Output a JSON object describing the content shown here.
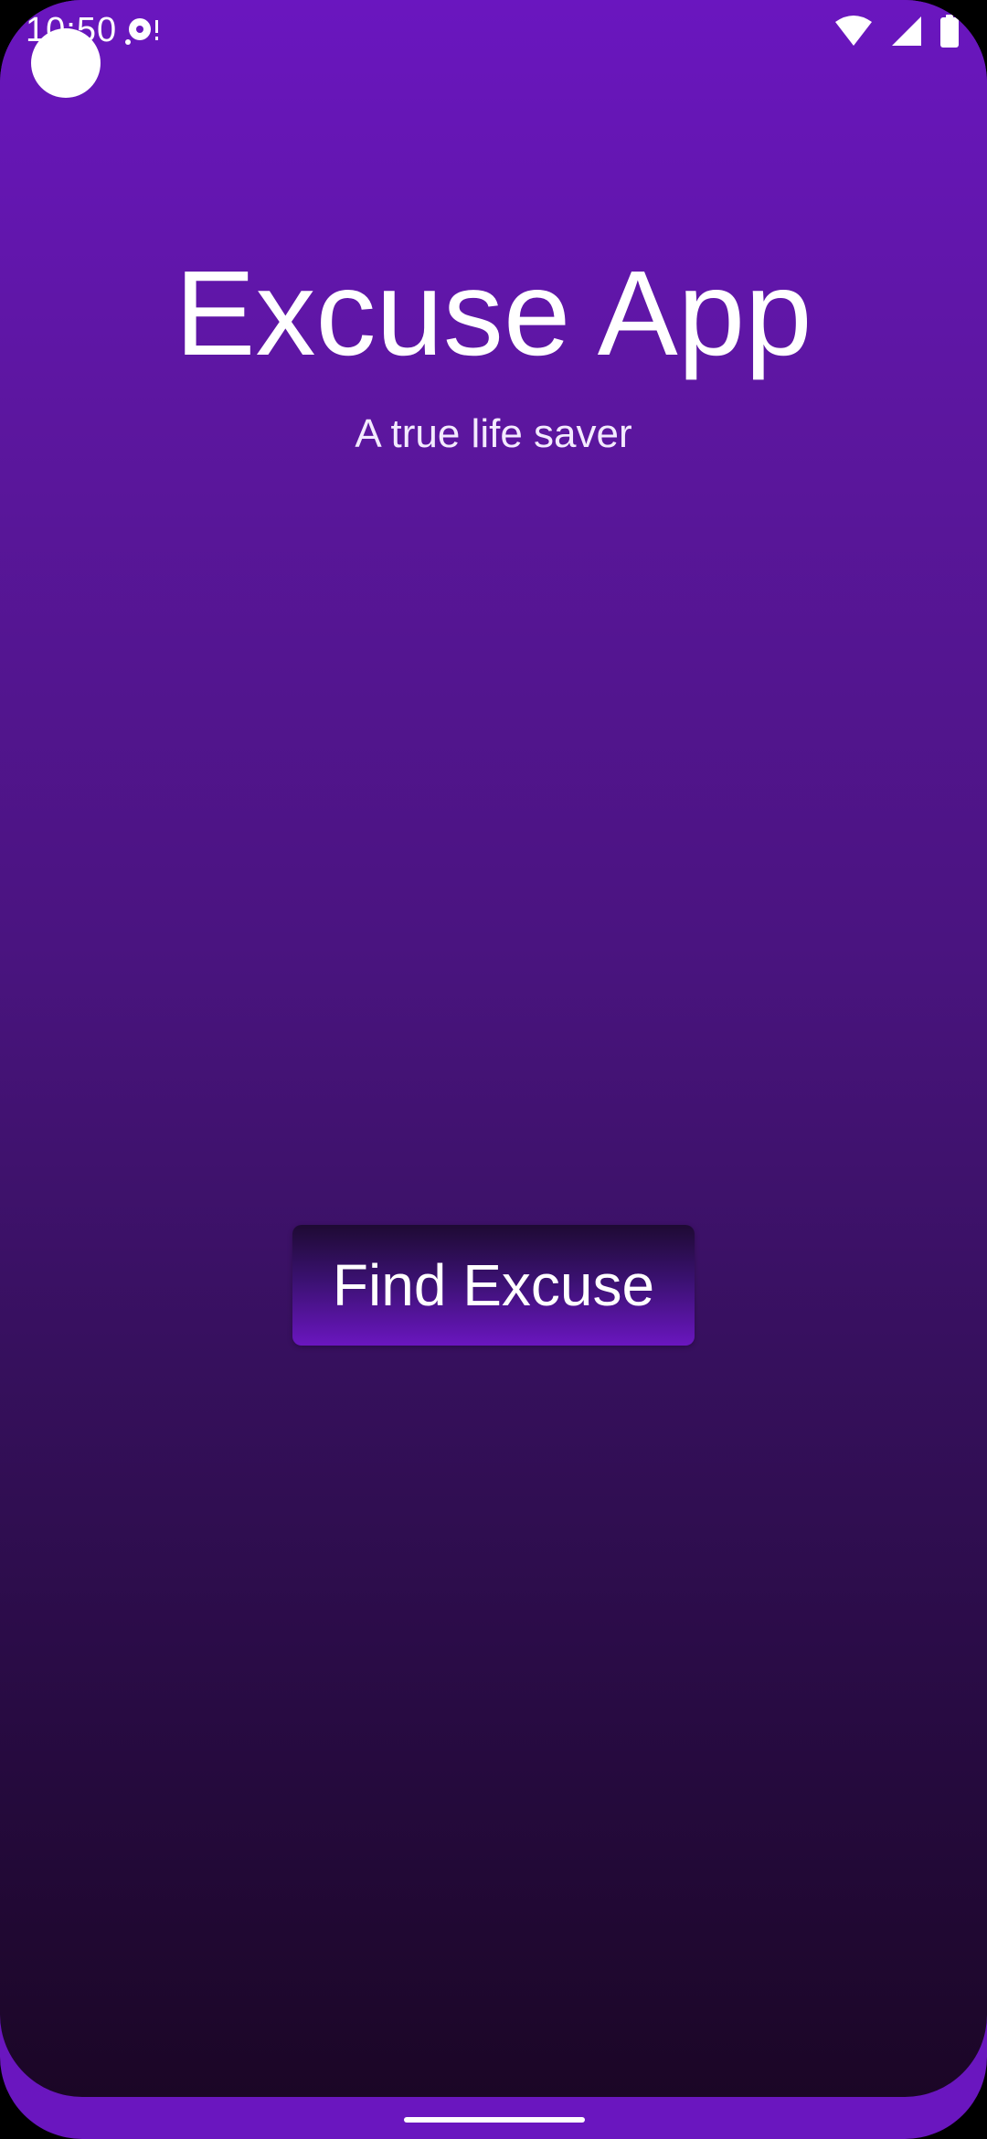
{
  "status_bar": {
    "time": "10:50",
    "icons": [
      "media-notification-icon",
      "wifi-icon",
      "cellular-signal-icon",
      "battery-icon"
    ]
  },
  "app": {
    "title": "Excuse App",
    "subtitle": "A true life saver",
    "primary_button_label": "Find Excuse"
  },
  "colors": {
    "top_gradient": "#6a16bf",
    "bottom_gradient": "#1b0626",
    "text": "#ffffff"
  }
}
